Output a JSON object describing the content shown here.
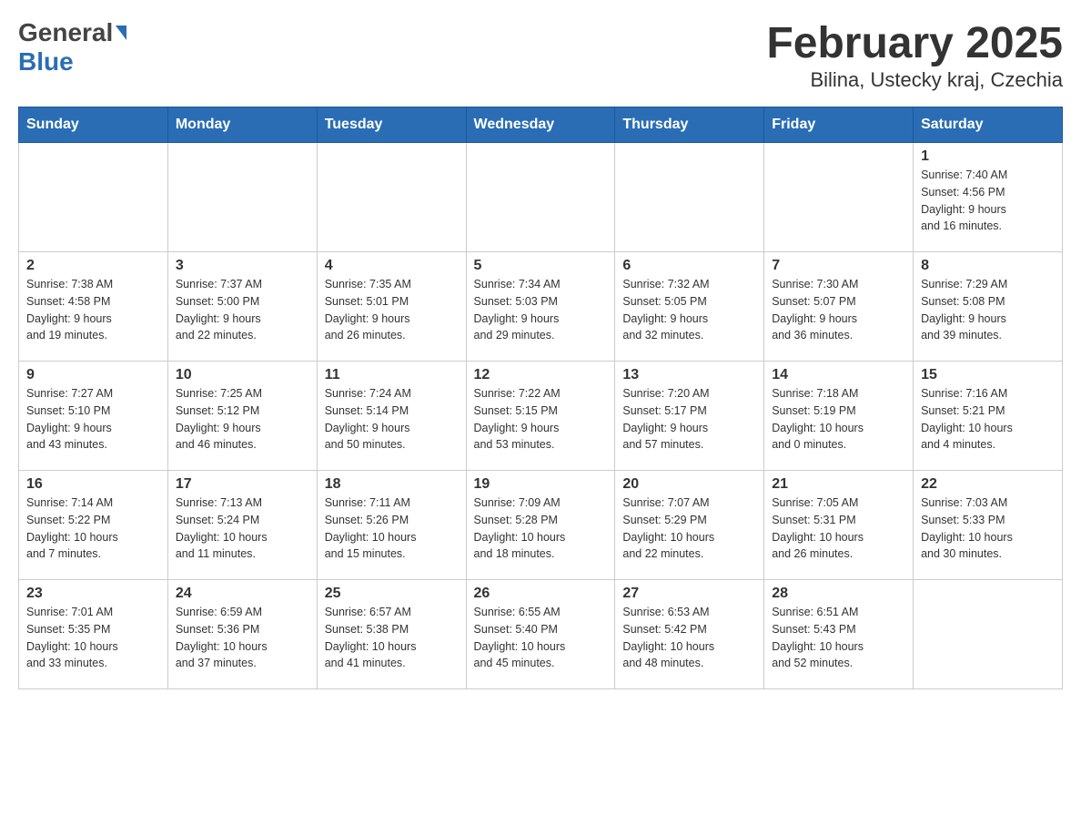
{
  "header": {
    "logo_general": "General",
    "logo_blue": "Blue",
    "title": "February 2025",
    "subtitle": "Bilina, Ustecky kraj, Czechia"
  },
  "days_of_week": [
    "Sunday",
    "Monday",
    "Tuesday",
    "Wednesday",
    "Thursday",
    "Friday",
    "Saturday"
  ],
  "weeks": [
    [
      {
        "day": "",
        "info": ""
      },
      {
        "day": "",
        "info": ""
      },
      {
        "day": "",
        "info": ""
      },
      {
        "day": "",
        "info": ""
      },
      {
        "day": "",
        "info": ""
      },
      {
        "day": "",
        "info": ""
      },
      {
        "day": "1",
        "info": "Sunrise: 7:40 AM\nSunset: 4:56 PM\nDaylight: 9 hours\nand 16 minutes."
      }
    ],
    [
      {
        "day": "2",
        "info": "Sunrise: 7:38 AM\nSunset: 4:58 PM\nDaylight: 9 hours\nand 19 minutes."
      },
      {
        "day": "3",
        "info": "Sunrise: 7:37 AM\nSunset: 5:00 PM\nDaylight: 9 hours\nand 22 minutes."
      },
      {
        "day": "4",
        "info": "Sunrise: 7:35 AM\nSunset: 5:01 PM\nDaylight: 9 hours\nand 26 minutes."
      },
      {
        "day": "5",
        "info": "Sunrise: 7:34 AM\nSunset: 5:03 PM\nDaylight: 9 hours\nand 29 minutes."
      },
      {
        "day": "6",
        "info": "Sunrise: 7:32 AM\nSunset: 5:05 PM\nDaylight: 9 hours\nand 32 minutes."
      },
      {
        "day": "7",
        "info": "Sunrise: 7:30 AM\nSunset: 5:07 PM\nDaylight: 9 hours\nand 36 minutes."
      },
      {
        "day": "8",
        "info": "Sunrise: 7:29 AM\nSunset: 5:08 PM\nDaylight: 9 hours\nand 39 minutes."
      }
    ],
    [
      {
        "day": "9",
        "info": "Sunrise: 7:27 AM\nSunset: 5:10 PM\nDaylight: 9 hours\nand 43 minutes."
      },
      {
        "day": "10",
        "info": "Sunrise: 7:25 AM\nSunset: 5:12 PM\nDaylight: 9 hours\nand 46 minutes."
      },
      {
        "day": "11",
        "info": "Sunrise: 7:24 AM\nSunset: 5:14 PM\nDaylight: 9 hours\nand 50 minutes."
      },
      {
        "day": "12",
        "info": "Sunrise: 7:22 AM\nSunset: 5:15 PM\nDaylight: 9 hours\nand 53 minutes."
      },
      {
        "day": "13",
        "info": "Sunrise: 7:20 AM\nSunset: 5:17 PM\nDaylight: 9 hours\nand 57 minutes."
      },
      {
        "day": "14",
        "info": "Sunrise: 7:18 AM\nSunset: 5:19 PM\nDaylight: 10 hours\nand 0 minutes."
      },
      {
        "day": "15",
        "info": "Sunrise: 7:16 AM\nSunset: 5:21 PM\nDaylight: 10 hours\nand 4 minutes."
      }
    ],
    [
      {
        "day": "16",
        "info": "Sunrise: 7:14 AM\nSunset: 5:22 PM\nDaylight: 10 hours\nand 7 minutes."
      },
      {
        "day": "17",
        "info": "Sunrise: 7:13 AM\nSunset: 5:24 PM\nDaylight: 10 hours\nand 11 minutes."
      },
      {
        "day": "18",
        "info": "Sunrise: 7:11 AM\nSunset: 5:26 PM\nDaylight: 10 hours\nand 15 minutes."
      },
      {
        "day": "19",
        "info": "Sunrise: 7:09 AM\nSunset: 5:28 PM\nDaylight: 10 hours\nand 18 minutes."
      },
      {
        "day": "20",
        "info": "Sunrise: 7:07 AM\nSunset: 5:29 PM\nDaylight: 10 hours\nand 22 minutes."
      },
      {
        "day": "21",
        "info": "Sunrise: 7:05 AM\nSunset: 5:31 PM\nDaylight: 10 hours\nand 26 minutes."
      },
      {
        "day": "22",
        "info": "Sunrise: 7:03 AM\nSunset: 5:33 PM\nDaylight: 10 hours\nand 30 minutes."
      }
    ],
    [
      {
        "day": "23",
        "info": "Sunrise: 7:01 AM\nSunset: 5:35 PM\nDaylight: 10 hours\nand 33 minutes."
      },
      {
        "day": "24",
        "info": "Sunrise: 6:59 AM\nSunset: 5:36 PM\nDaylight: 10 hours\nand 37 minutes."
      },
      {
        "day": "25",
        "info": "Sunrise: 6:57 AM\nSunset: 5:38 PM\nDaylight: 10 hours\nand 41 minutes."
      },
      {
        "day": "26",
        "info": "Sunrise: 6:55 AM\nSunset: 5:40 PM\nDaylight: 10 hours\nand 45 minutes."
      },
      {
        "day": "27",
        "info": "Sunrise: 6:53 AM\nSunset: 5:42 PM\nDaylight: 10 hours\nand 48 minutes."
      },
      {
        "day": "28",
        "info": "Sunrise: 6:51 AM\nSunset: 5:43 PM\nDaylight: 10 hours\nand 52 minutes."
      },
      {
        "day": "",
        "info": ""
      }
    ]
  ]
}
